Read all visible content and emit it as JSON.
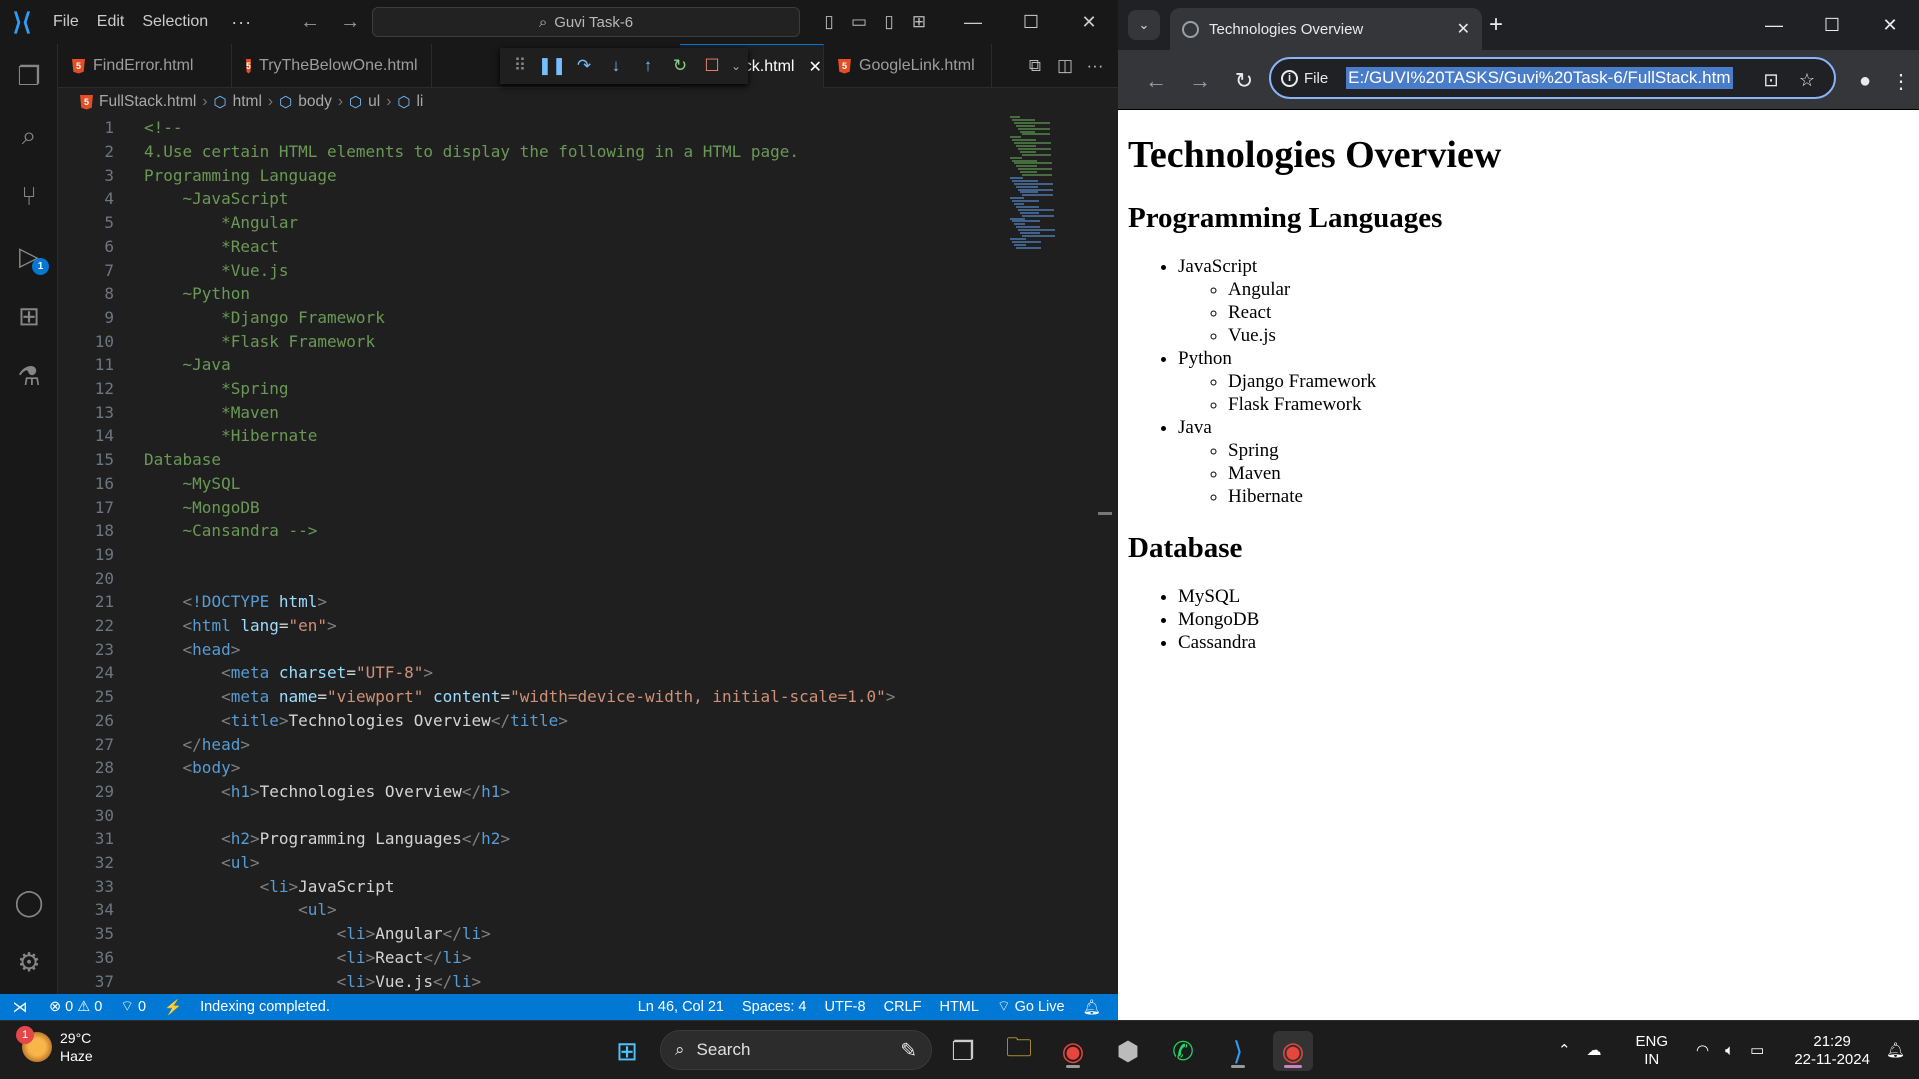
{
  "vscode": {
    "menu": [
      "File",
      "Edit",
      "Selection"
    ],
    "more_menu": "···",
    "search_text": "Guvi Task-6",
    "tabs": [
      {
        "label": "FindError.html",
        "active": false
      },
      {
        "label": "TryTheBelowOne.html",
        "active": false
      },
      {
        "label": "FullStack.html",
        "active": true
      },
      {
        "label": "GoogleLink.html",
        "active": false
      }
    ],
    "breadcrumb": [
      "FullStack.html",
      "html",
      "body",
      "ul",
      "li"
    ],
    "activity_badge": "1",
    "code_lines": [
      {
        "n": "1",
        "html": "<span class='c-com'>&lt;!--</span>"
      },
      {
        "n": "2",
        "html": "<span class='c-com'>4.Use certain HTML elements to display the following in a HTML page.</span>"
      },
      {
        "n": "3",
        "html": "<span class='c-com'>Programming Language</span>"
      },
      {
        "n": "4",
        "html": "<span class='c-com'>    ~JavaScript</span>"
      },
      {
        "n": "5",
        "html": "<span class='c-com'>        *Angular</span>"
      },
      {
        "n": "6",
        "html": "<span class='c-com'>        *React</span>"
      },
      {
        "n": "7",
        "html": "<span class='c-com'>        *Vue.js</span>"
      },
      {
        "n": "8",
        "html": "<span class='c-com'>    ~Python</span>"
      },
      {
        "n": "9",
        "html": "<span class='c-com'>        *Django Framework</span>"
      },
      {
        "n": "10",
        "html": "<span class='c-com'>        *Flask Framework</span>"
      },
      {
        "n": "11",
        "html": "<span class='c-com'>    ~Java</span>"
      },
      {
        "n": "12",
        "html": "<span class='c-com'>        *Spring</span>"
      },
      {
        "n": "13",
        "html": "<span class='c-com'>        *Maven</span>"
      },
      {
        "n": "14",
        "html": "<span class='c-com'>        *Hibernate</span>"
      },
      {
        "n": "15",
        "html": "<span class='c-com'>Database</span>"
      },
      {
        "n": "16",
        "html": "<span class='c-com'>    ~MySQL</span>"
      },
      {
        "n": "17",
        "html": "<span class='c-com'>    ~MongoDB</span>"
      },
      {
        "n": "18",
        "html": "<span class='c-com'>    ~Cansandra --&gt;</span>"
      },
      {
        "n": "19",
        "html": ""
      },
      {
        "n": "20",
        "html": ""
      },
      {
        "n": "21",
        "html": "    <span class='c-br'>&lt;</span><span class='c-tag'>!DOCTYPE</span> <span class='c-attr'>html</span><span class='c-br'>&gt;</span>"
      },
      {
        "n": "22",
        "html": "    <span class='c-br'>&lt;</span><span class='c-tag'>html</span> <span class='c-attr'>lang</span><span class='c-txt'>=</span><span class='c-val'>\"en\"</span><span class='c-br'>&gt;</span>"
      },
      {
        "n": "23",
        "html": "    <span class='c-br'>&lt;</span><span class='c-tag'>head</span><span class='c-br'>&gt;</span>"
      },
      {
        "n": "24",
        "html": "        <span class='c-br'>&lt;</span><span class='c-tag'>meta</span> <span class='c-attr'>charset</span><span class='c-txt'>=</span><span class='c-val'>\"UTF-8\"</span><span class='c-br'>&gt;</span>"
      },
      {
        "n": "25",
        "html": "        <span class='c-br'>&lt;</span><span class='c-tag'>meta</span> <span class='c-attr'>name</span><span class='c-txt'>=</span><span class='c-val'>\"viewport\"</span> <span class='c-attr'>content</span><span class='c-txt'>=</span><span class='c-val'>\"width=device-width, initial-scale=1.0\"</span><span class='c-br'>&gt;</span>"
      },
      {
        "n": "26",
        "html": "        <span class='c-br'>&lt;</span><span class='c-tag'>title</span><span class='c-br'>&gt;</span><span class='c-txt'>Technologies Overview</span><span class='c-br'>&lt;/</span><span class='c-tag'>title</span><span class='c-br'>&gt;</span>"
      },
      {
        "n": "27",
        "html": "    <span class='c-br'>&lt;/</span><span class='c-tag'>head</span><span class='c-br'>&gt;</span>"
      },
      {
        "n": "28",
        "html": "    <span class='c-br'>&lt;</span><span class='c-tag'>body</span><span class='c-br'>&gt;</span>"
      },
      {
        "n": "29",
        "html": "        <span class='c-br'>&lt;</span><span class='c-tag'>h1</span><span class='c-br'>&gt;</span><span class='c-txt'>Technologies Overview</span><span class='c-br'>&lt;/</span><span class='c-tag'>h1</span><span class='c-br'>&gt;</span>"
      },
      {
        "n": "30",
        "html": ""
      },
      {
        "n": "31",
        "html": "        <span class='c-br'>&lt;</span><span class='c-tag'>h2</span><span class='c-br'>&gt;</span><span class='c-txt'>Programming Languages</span><span class='c-br'>&lt;/</span><span class='c-tag'>h2</span><span class='c-br'>&gt;</span>"
      },
      {
        "n": "32",
        "html": "        <span class='c-br'>&lt;</span><span class='c-tag'>ul</span><span class='c-br'>&gt;</span>"
      },
      {
        "n": "33",
        "html": "            <span class='c-br'>&lt;</span><span class='c-tag'>li</span><span class='c-br'>&gt;</span><span class='c-txt'>JavaScript</span>"
      },
      {
        "n": "34",
        "html": "                <span class='c-br'>&lt;</span><span class='c-tag'>ul</span><span class='c-br'>&gt;</span>"
      },
      {
        "n": "35",
        "html": "                    <span class='c-br'>&lt;</span><span class='c-tag'>li</span><span class='c-br'>&gt;</span><span class='c-txt'>Angular</span><span class='c-br'>&lt;/</span><span class='c-tag'>li</span><span class='c-br'>&gt;</span>"
      },
      {
        "n": "36",
        "html": "                    <span class='c-br'>&lt;</span><span class='c-tag'>li</span><span class='c-br'>&gt;</span><span class='c-txt'>React</span><span class='c-br'>&lt;/</span><span class='c-tag'>li</span><span class='c-br'>&gt;</span>"
      },
      {
        "n": "37",
        "html": "                    <span class='c-br'>&lt;</span><span class='c-tag'>li</span><span class='c-br'>&gt;</span><span class='c-txt'>Vue.js</span><span class='c-br'>&lt;/</span><span class='c-tag'>li</span><span class='c-br'>&gt;</span>"
      }
    ],
    "status": {
      "errors": "0",
      "warnings": "0",
      "ports": "0",
      "message": "Indexing completed.",
      "position": "Ln 46, Col 21",
      "spaces": "Spaces: 4",
      "encoding": "UTF-8",
      "eol": "CRLF",
      "language": "HTML",
      "golive": "Go Live"
    }
  },
  "chrome": {
    "tab_title": "Technologies Overview",
    "info_label": "File",
    "url": "E:/GUVI%20TASKS/Guvi%20Task-6/FullStack.htm",
    "page": {
      "h1": "Technologies Overview",
      "sections": [
        {
          "heading": "Programming Languages",
          "items": [
            {
              "label": "JavaScript",
              "children": [
                "Angular",
                "React",
                "Vue.js"
              ]
            },
            {
              "label": "Python",
              "children": [
                "Django Framework",
                "Flask Framework"
              ]
            },
            {
              "label": "Java",
              "children": [
                "Spring",
                "Maven",
                "Hibernate"
              ]
            }
          ]
        },
        {
          "heading": "Database",
          "items": [
            {
              "label": "MySQL",
              "children": []
            },
            {
              "label": "MongoDB",
              "children": []
            },
            {
              "label": "Cassandra",
              "children": []
            }
          ]
        }
      ]
    }
  },
  "taskbar": {
    "weather_temp": "29°C",
    "weather_desc": "Haze",
    "weather_badge": "1",
    "search_label": "Search",
    "lang_top": "ENG",
    "lang_bottom": "IN",
    "time": "21:29",
    "date": "22-11-2024"
  },
  "colors": {
    "vscode_accent": "#0078d4",
    "comment": "#6a9955",
    "tag": "#569cd6",
    "attr": "#9cdcfe",
    "string": "#ce9178"
  }
}
